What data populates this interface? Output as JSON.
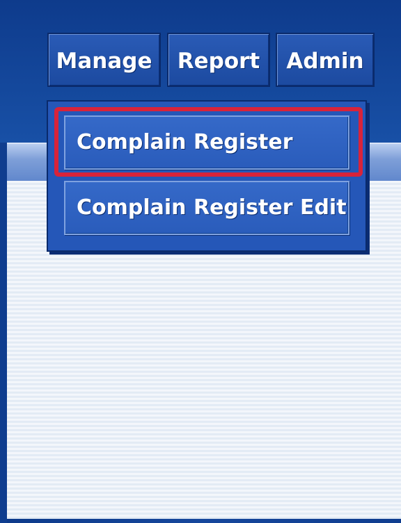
{
  "menu_bar": {
    "tabs": [
      {
        "label": "Manage"
      },
      {
        "label": "Report"
      },
      {
        "label": "Admin"
      }
    ]
  },
  "dropdown": {
    "items": [
      {
        "label": "Complain Register",
        "highlighted": true
      },
      {
        "label": "Complain Register Edit",
        "highlighted": false
      }
    ]
  },
  "colors": {
    "header_blue": "#1850a6",
    "highlight_red": "#d8233a",
    "menu_text": "#ffffff"
  }
}
